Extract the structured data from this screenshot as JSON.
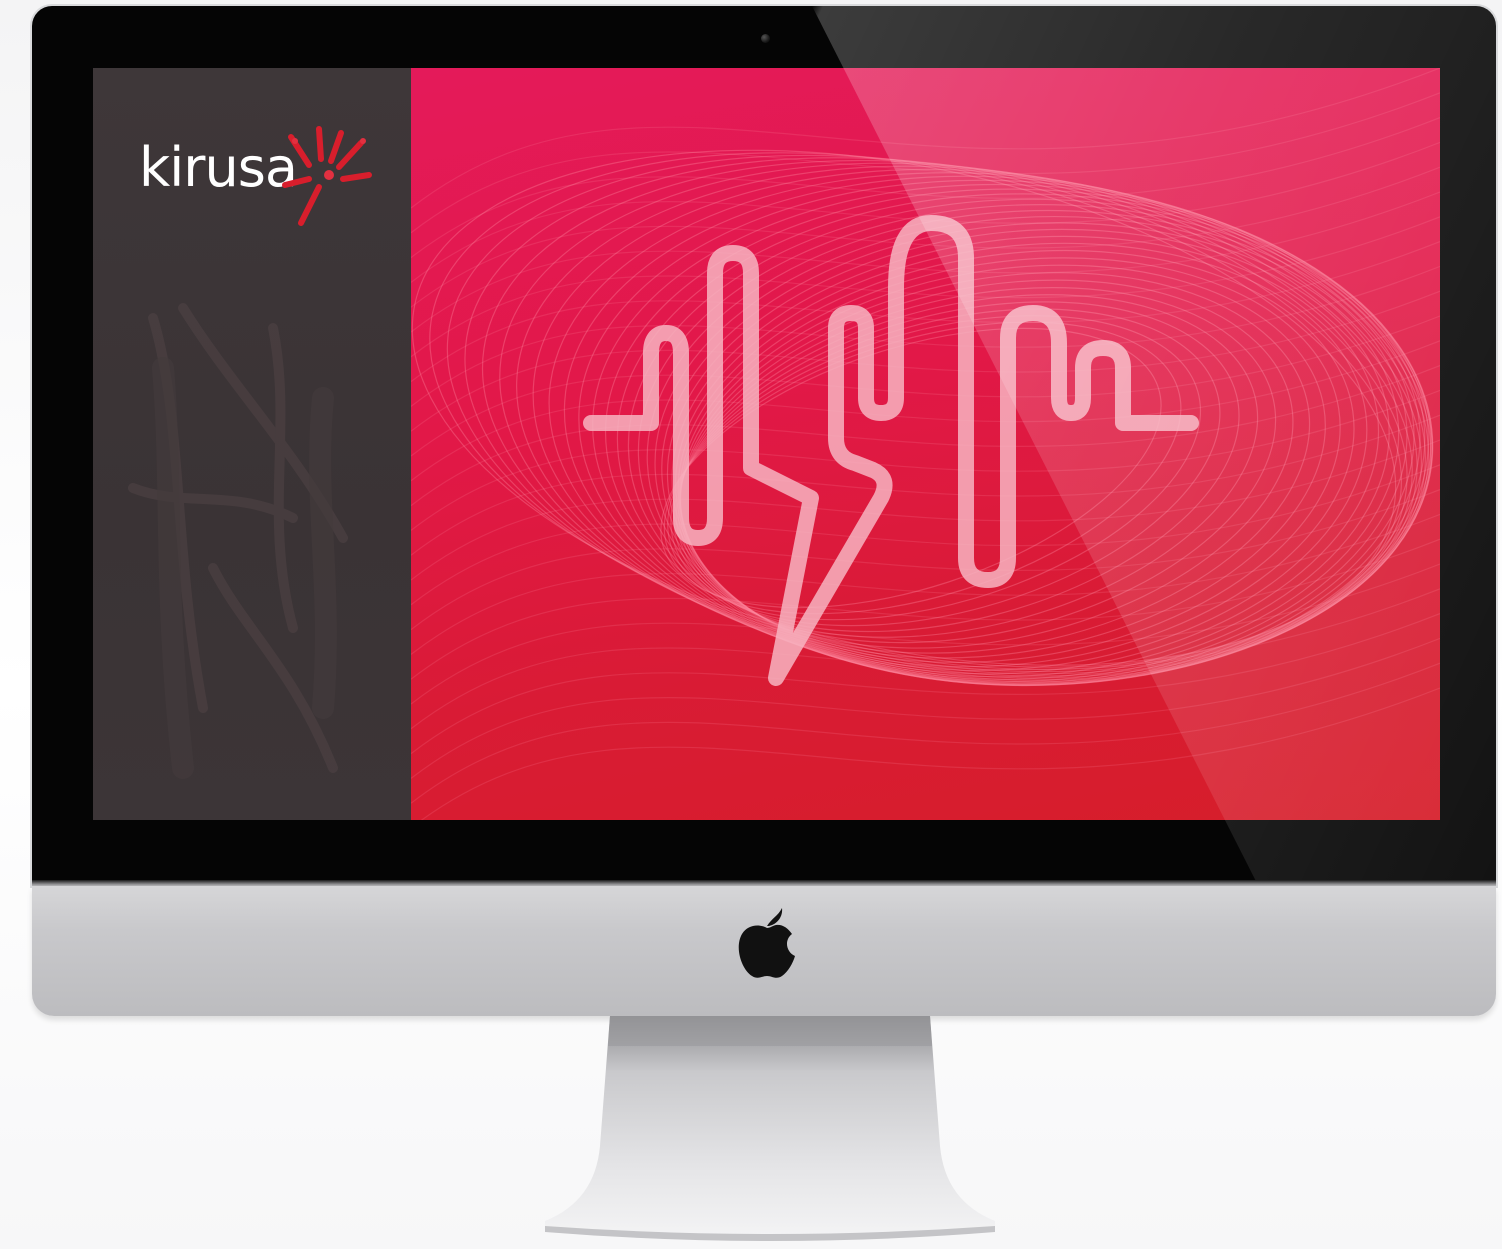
{
  "device": {
    "type": "desktop-monitor",
    "brand_icon": "apple-logo-icon",
    "colors": {
      "bezel": "#050505",
      "aluminum": "#c8c8cb",
      "background": "#f7f7f8"
    }
  },
  "screen": {
    "sidebar": {
      "logo_text": "kirusa",
      "logo_icon": "red-burst-icon",
      "background_color": "#3b3537"
    },
    "hero": {
      "background_color": "#e21848",
      "graphic_icon": "sound-wave-icon",
      "pattern_icon": "wire-mesh-pattern"
    }
  }
}
